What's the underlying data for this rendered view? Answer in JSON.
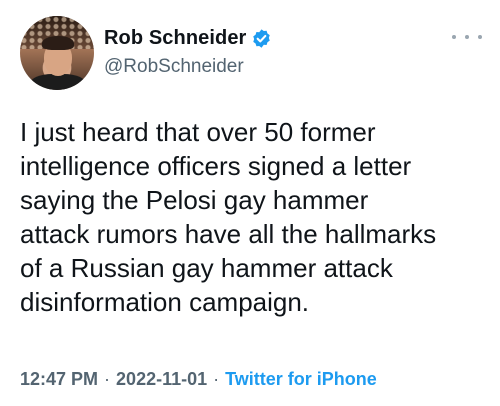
{
  "author": {
    "display_name": "Rob Schneider",
    "handle": "@RobSchneider",
    "verified": true
  },
  "tweet": {
    "text": "I just heard that over 50 former\nintelligence officers signed a letter\nsaying the  Pelosi gay hammer\nattack rumors have all the hallmarks\nof a Russian gay hammer attack\ndisinformation campaign.",
    "time": "12:47 PM",
    "separator": "·",
    "date": "2022-11-01",
    "source": "Twitter for iPhone"
  },
  "colors": {
    "text": "#0f1419",
    "muted": "#536471",
    "accent": "#1d9bf0"
  },
  "icons": {
    "verified": "verified-badge-icon",
    "more": "more-options-icon"
  }
}
